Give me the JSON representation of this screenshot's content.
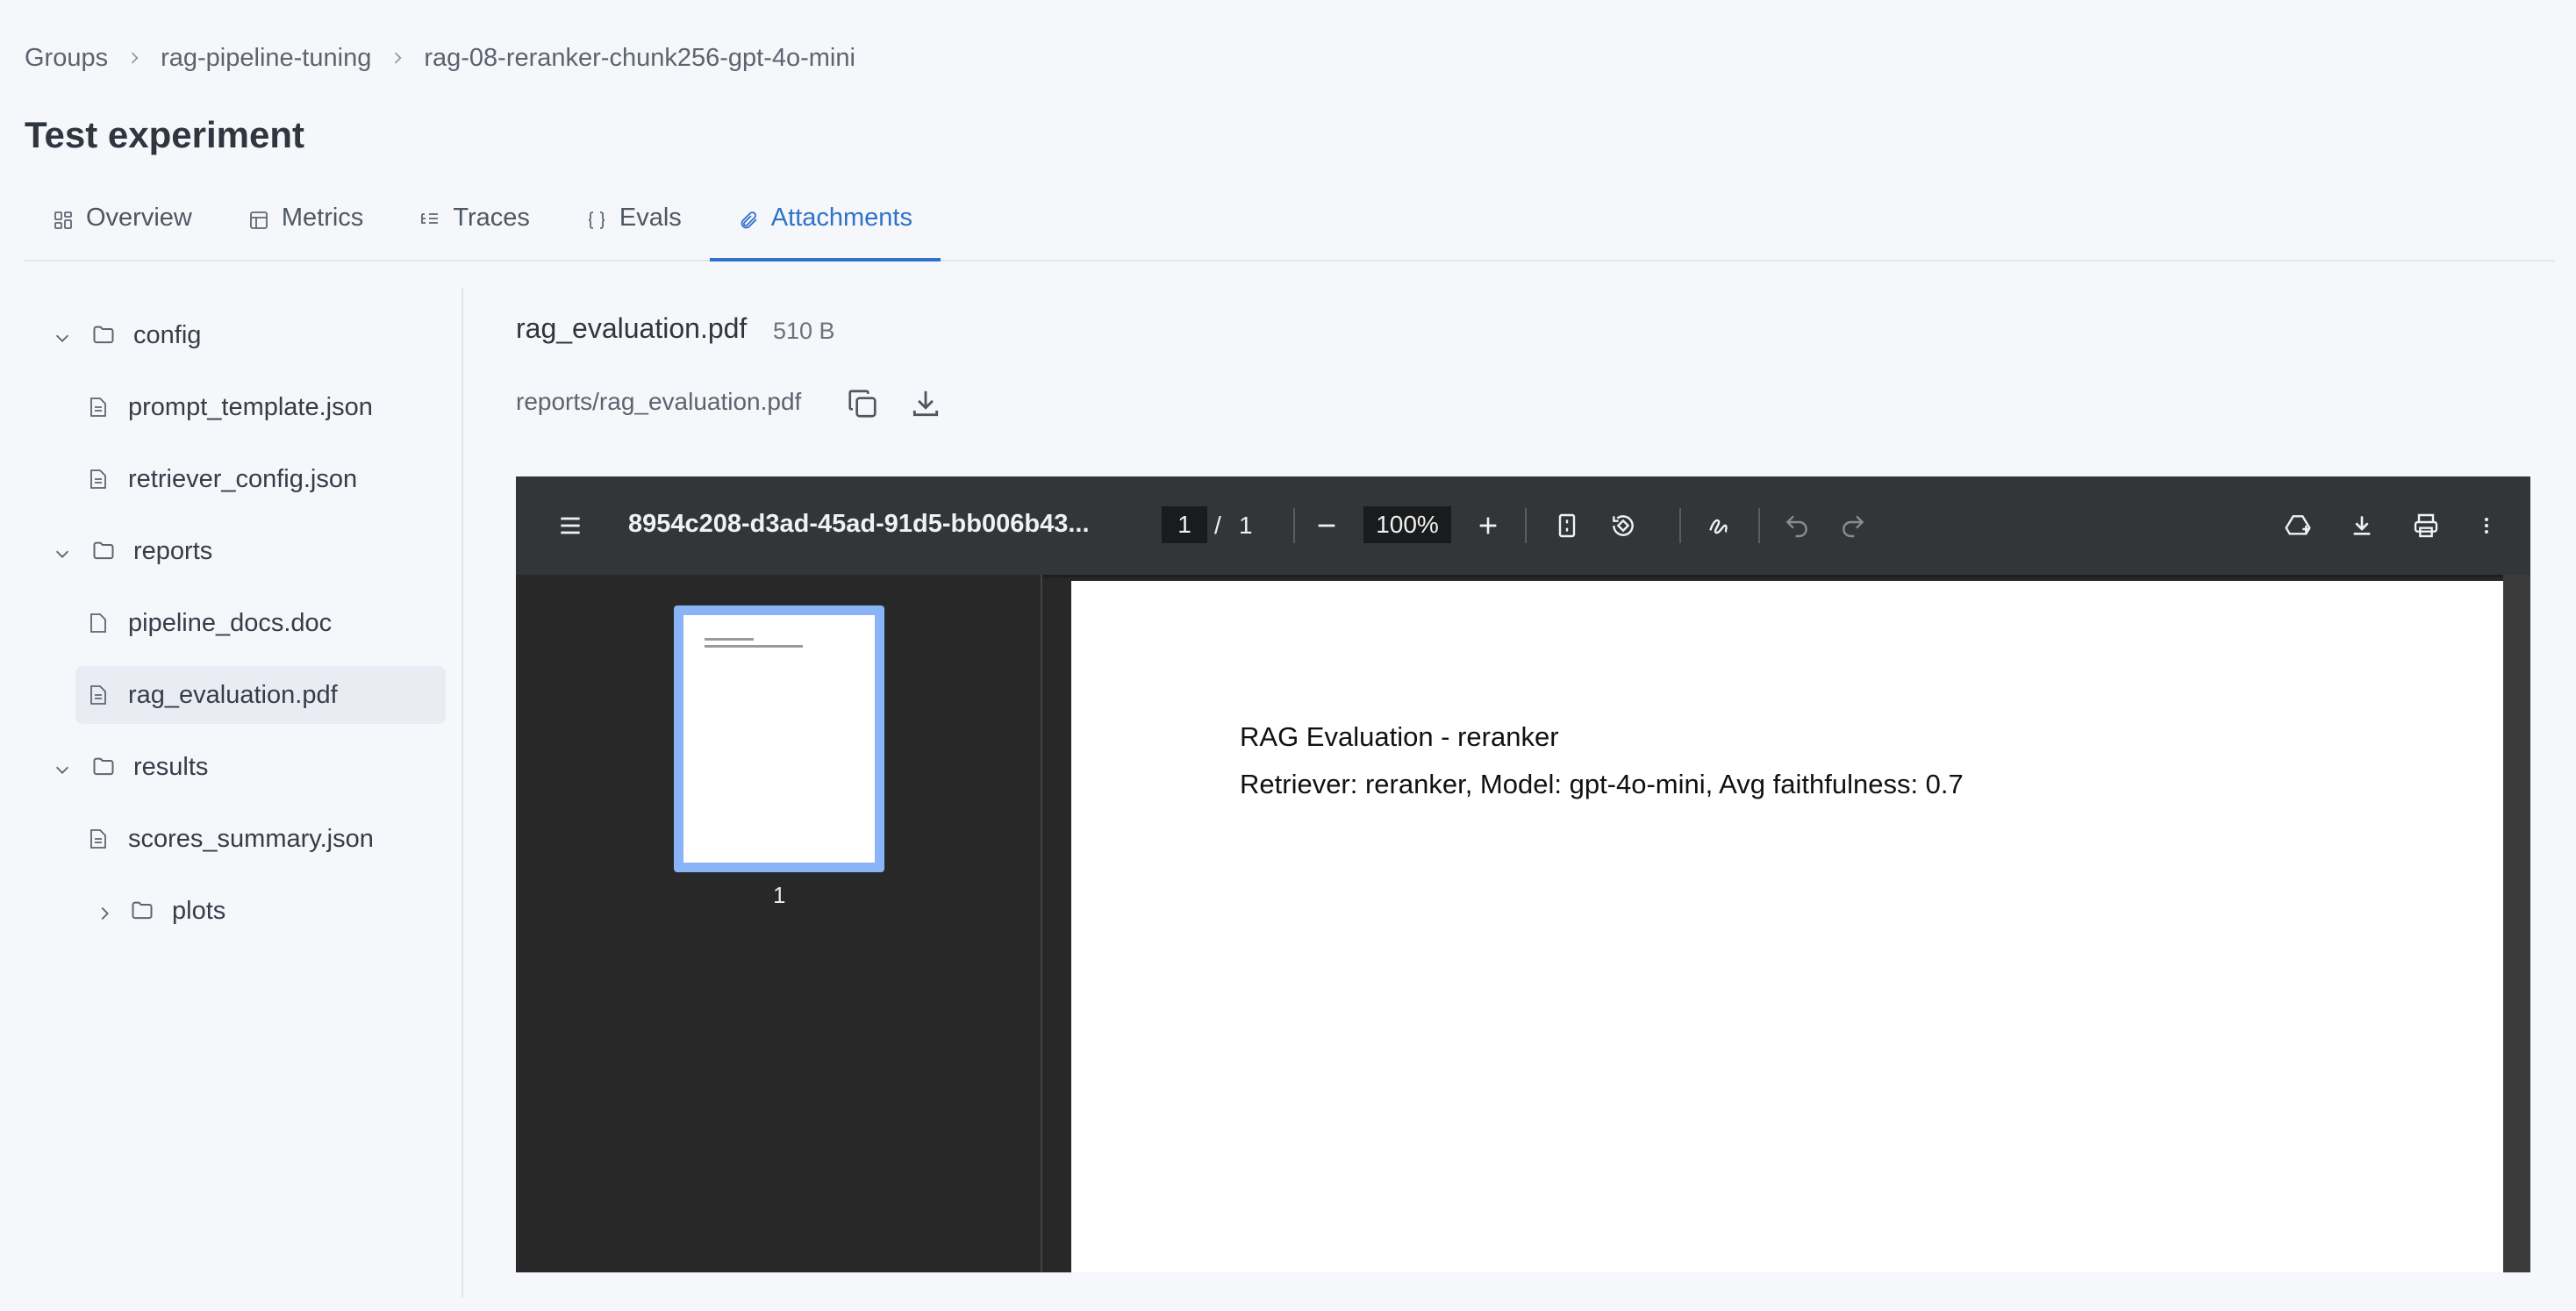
{
  "breadcrumb": [
    "Groups",
    "rag-pipeline-tuning",
    "rag-08-reranker-chunk256-gpt-4o-mini"
  ],
  "page_title": "Test experiment",
  "tabs": [
    {
      "label": "Overview",
      "icon": "grid-icon"
    },
    {
      "label": "Metrics",
      "icon": "table-icon"
    },
    {
      "label": "Traces",
      "icon": "list-tree-icon"
    },
    {
      "label": "Evals",
      "icon": "braces-icon"
    },
    {
      "label": "Attachments",
      "icon": "paperclip-icon",
      "active": true
    }
  ],
  "tree": [
    {
      "label": "config",
      "type": "folder",
      "expanded": true
    },
    {
      "label": "prompt_template.json",
      "type": "file"
    },
    {
      "label": "retriever_config.json",
      "type": "file"
    },
    {
      "label": "reports",
      "type": "folder",
      "expanded": true
    },
    {
      "label": "pipeline_docs.doc",
      "type": "file"
    },
    {
      "label": "rag_evaluation.pdf",
      "type": "file",
      "selected": true
    },
    {
      "label": "results",
      "type": "folder",
      "expanded": true
    },
    {
      "label": "scores_summary.json",
      "type": "file"
    },
    {
      "label": "plots",
      "type": "folder",
      "expanded": false
    }
  ],
  "file": {
    "name": "rag_evaluation.pdf",
    "size": "510 B",
    "path": "reports/rag_evaluation.pdf"
  },
  "viewer": {
    "title": "8954c208-d3ad-45ad-91d5-bb006b43...",
    "current_page": "1",
    "page_separator": "/",
    "total_pages": "1",
    "zoom": "100%",
    "thumbnail_label": "1",
    "accent_color": "#8ab4f8"
  },
  "pdf": {
    "line1": "RAG Evaluation - reranker",
    "line2": "Retriever: reranker, Model: gpt-4o-mini, Avg faithfulness: 0.7"
  },
  "colors": {
    "accent": "#2f72c9",
    "background": "#f5f7fa"
  }
}
